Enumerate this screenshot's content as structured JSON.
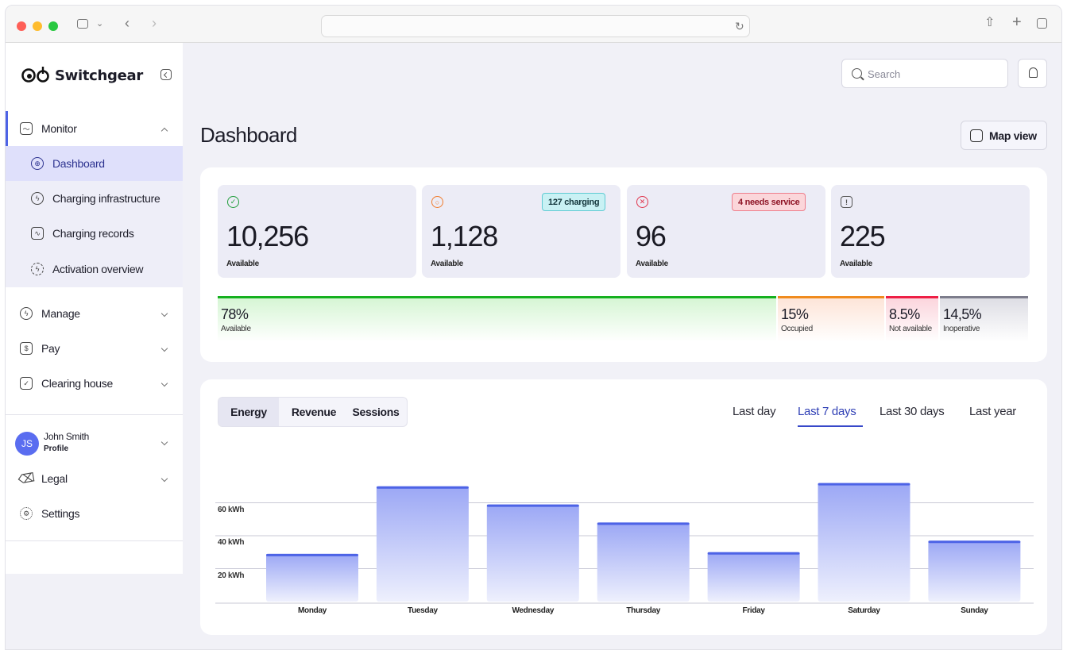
{
  "app": {
    "name": "Switchgear"
  },
  "sidebar": {
    "sections": [
      {
        "label": "Monitor",
        "icon": "chart-icon",
        "expanded": true
      },
      {
        "label": "Manage",
        "icon": "bolt-icon",
        "expanded": false
      },
      {
        "label": "Pay",
        "icon": "dollar-icon",
        "expanded": false
      },
      {
        "label": "Clearing house",
        "icon": "clipboard-icon",
        "expanded": false
      }
    ],
    "monitor_items": [
      {
        "label": "Dashboard",
        "icon": "grid-icon",
        "active": true
      },
      {
        "label": "Charging infrastructure",
        "icon": "charger-icon"
      },
      {
        "label": "Charging records",
        "icon": "activity-icon"
      },
      {
        "label": "Activation overview",
        "icon": "activation-icon"
      }
    ],
    "user": {
      "initials": "JS",
      "name": "John Smith",
      "sub": "Profile"
    },
    "legal": "Legal",
    "settings": "Settings"
  },
  "header": {
    "search_placeholder": "Search",
    "page_title": "Dashboard",
    "map_view": "Map view"
  },
  "stats": [
    {
      "value": "10,256",
      "caption": "Available",
      "icon": "check-circle-icon",
      "color": "#1f9d3a",
      "badge": ""
    },
    {
      "value": "1,128",
      "caption": "Available",
      "icon": "charging-icon",
      "color": "#f07b2b",
      "badge": "127 charging",
      "badge_bg": "#c9f1f4",
      "badge_border": "#5fcbd3",
      "badge_color": "#12343a"
    },
    {
      "value": "96",
      "caption": "Available",
      "icon": "x-circle-icon",
      "color": "#e0334b",
      "badge": "4 needs service",
      "badge_bg": "#fbd6da",
      "badge_border": "#ee7e8c",
      "badge_color": "#8e1425"
    },
    {
      "value": "225",
      "caption": "Available",
      "icon": "alert-icon",
      "color": "#555555",
      "badge": ""
    }
  ],
  "status_bar": [
    {
      "pct": "78%",
      "label": "Available",
      "fraction": 0.78,
      "color": "#15b01e",
      "tint": "#d4f5d2"
    },
    {
      "pct": "15%",
      "label": "Occupied",
      "fraction": 0.15,
      "color": "#f08b1e",
      "tint": "#fde3d6"
    },
    {
      "pct": "8.5%",
      "label": "Not available",
      "fraction": 0.075,
      "color": "#ee1f45",
      "tint": "#fbd3db"
    },
    {
      "pct": "14,5%",
      "label": "Inoperative",
      "fraction": 0.125,
      "color": "#7d7d8c",
      "tint": "#dcdce3"
    }
  ],
  "chart_tabs": [
    "Energy",
    "Revenue",
    "Sessions"
  ],
  "active_chart_tab": "Energy",
  "ranges": [
    "Last day",
    "Last 7 days",
    "Last 30 days",
    "Last year"
  ],
  "active_range": "Last 7 days",
  "colors": {
    "accent": "#4d63e6",
    "bar_top": "#4d63e6"
  },
  "chart_data": {
    "type": "bar",
    "categories": [
      "Monday",
      "Tuesday",
      "Wednesday",
      "Thursday",
      "Friday",
      "Saturday",
      "Sunday"
    ],
    "values": [
      29,
      70,
      59,
      48,
      30,
      72,
      37
    ],
    "yticks": [
      "20 kWh",
      "40 kWh",
      "60 kWh"
    ],
    "ytick_values": [
      20,
      40,
      60
    ],
    "ylim": [
      0,
      80
    ],
    "unit": "kWh",
    "grid": true
  }
}
